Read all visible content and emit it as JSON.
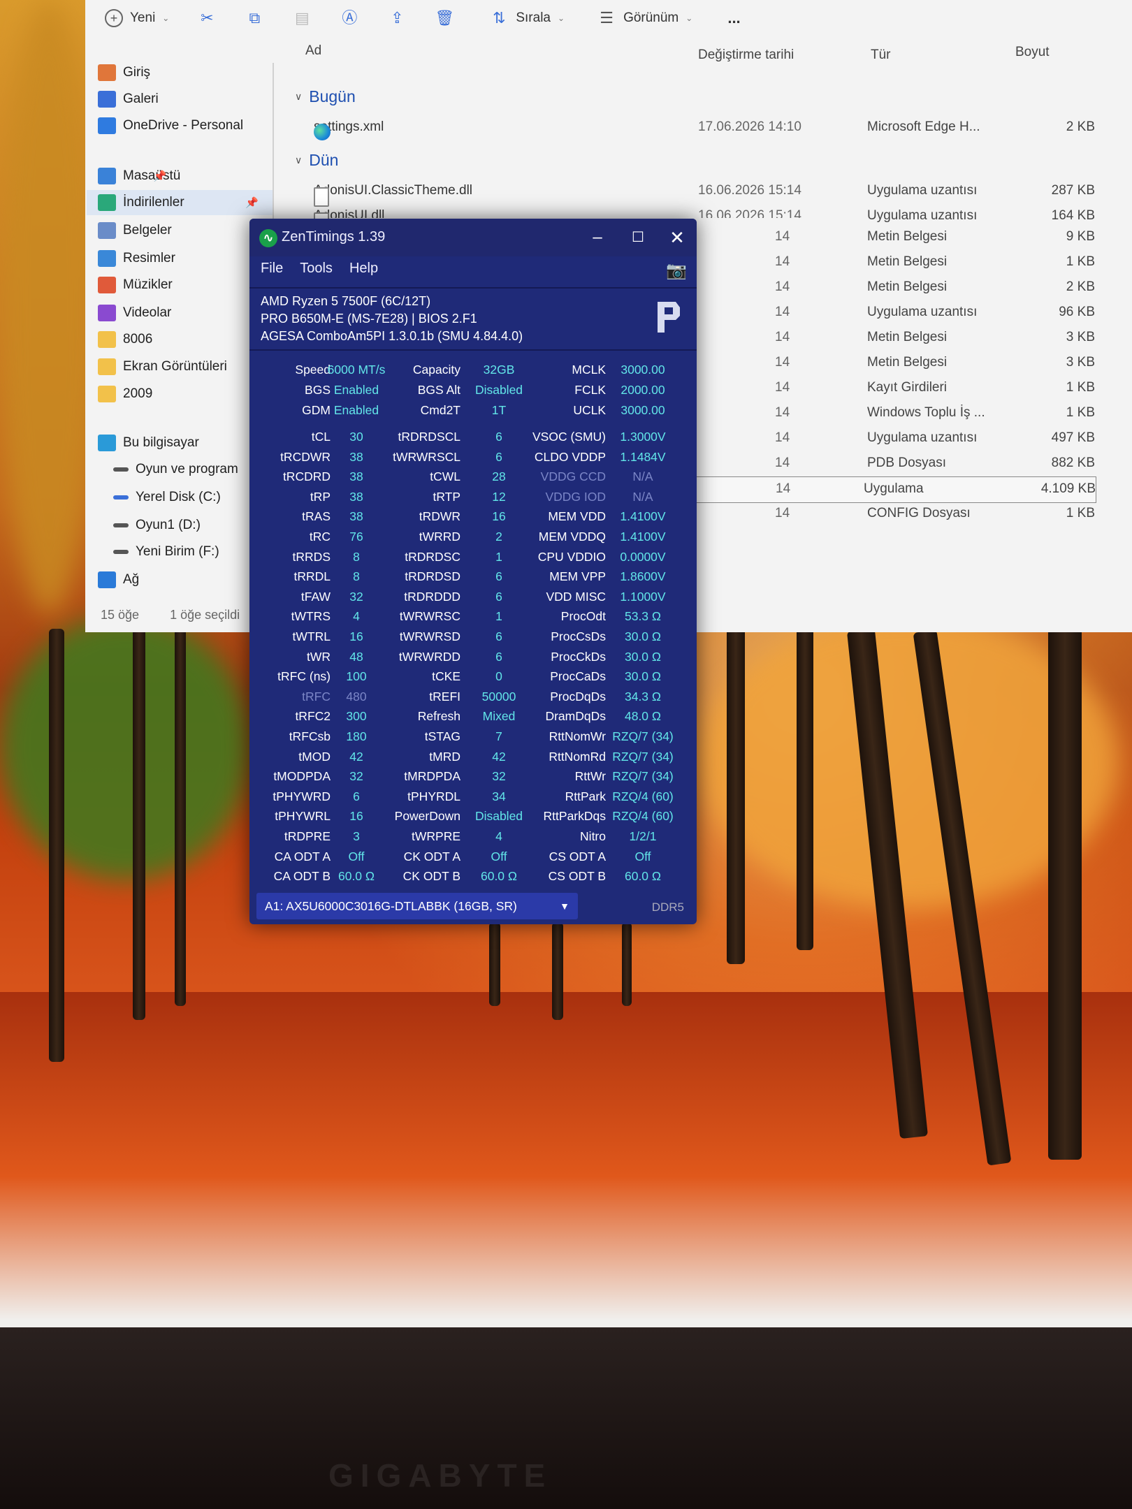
{
  "explorer": {
    "toolbar": {
      "new_label": "Yeni",
      "sort_label": "Sırala",
      "view_label": "Görünüm",
      "more_label": "..."
    },
    "columns": {
      "name": "Ad",
      "date": "Değiştirme tarihi",
      "type": "Tür",
      "size": "Boyut"
    },
    "sidebar": [
      {
        "label": "Giriş",
        "color": "#e0763a"
      },
      {
        "label": "Galeri",
        "color": "#3a6fd8"
      },
      {
        "label": "OneDrive - Personal",
        "color": "#2f7be0"
      },
      {
        "label": "Masaüstü",
        "color": "#3a82d8"
      },
      {
        "label": "İndirilenler",
        "color": "#2aa87a"
      },
      {
        "label": "Belgeler",
        "color": "#6a8cc8"
      },
      {
        "label": "Resimler",
        "color": "#3a88d8"
      },
      {
        "label": "Müzikler",
        "color": "#e05a3a"
      },
      {
        "label": "Videolar",
        "color": "#8a4ad0"
      },
      {
        "label": "8006",
        "color": "#f2c14a"
      },
      {
        "label": "Ekran Görüntüleri",
        "color": "#f2c14a"
      },
      {
        "label": "2009",
        "color": "#f2c14a"
      },
      {
        "label": "Bu bilgisayar",
        "color": "#2a9ad8"
      },
      {
        "label": "Oyun ve program",
        "color": "#555555"
      },
      {
        "label": "Yerel Disk (C:)",
        "color": "#3a6fd8"
      },
      {
        "label": "Oyun1 (D:)",
        "color": "#555555"
      },
      {
        "label": "Yeni Birim (F:)",
        "color": "#555555"
      },
      {
        "label": "Ağ",
        "color": "#2a7ad8"
      }
    ],
    "groups": {
      "today": "Bugün",
      "yesterday": "Dün"
    },
    "files": [
      {
        "name": "settings.xml",
        "date": "17.06.2026 14:10",
        "type": "Microsoft Edge H...",
        "size": "2 KB"
      },
      {
        "name": "AdonisUI.ClassicTheme.dll",
        "date": "16.06.2026 15:14",
        "type": "Uygulama uzantısı",
        "size": "287 KB"
      },
      {
        "name": "AdonisUI.dll",
        "date": "16.06.2026 15:14",
        "type": "Uygulama uzantısı",
        "size": "164 KB"
      },
      {
        "name": "",
        "date": "14",
        "type": "Metin Belgesi",
        "size": "9 KB"
      },
      {
        "name": "",
        "date": "14",
        "type": "Metin Belgesi",
        "size": "1 KB"
      },
      {
        "name": "",
        "date": "14",
        "type": "Metin Belgesi",
        "size": "2 KB"
      },
      {
        "name": "",
        "date": "14",
        "type": "Uygulama uzantısı",
        "size": "96 KB"
      },
      {
        "name": "",
        "date": "14",
        "type": "Metin Belgesi",
        "size": "3 KB"
      },
      {
        "name": "",
        "date": "14",
        "type": "Metin Belgesi",
        "size": "3 KB"
      },
      {
        "name": "",
        "date": "14",
        "type": "Kayıt Girdileri",
        "size": "1 KB"
      },
      {
        "name": "",
        "date": "14",
        "type": "Windows Toplu İş ...",
        "size": "1 KB"
      },
      {
        "name": "",
        "date": "14",
        "type": "Uygulama uzantısı",
        "size": "497 KB"
      },
      {
        "name": "",
        "date": "14",
        "type": "PDB Dosyası",
        "size": "882 KB"
      },
      {
        "name": "",
        "date": "14",
        "type": "Uygulama",
        "size": "4.109 KB"
      },
      {
        "name": "",
        "date": "14",
        "type": "CONFIG Dosyası",
        "size": "1 KB"
      }
    ],
    "status": {
      "count": "15 öğe",
      "selected": "1 öğe seçildi"
    }
  },
  "zen": {
    "title": "ZenTimings 1.39",
    "menu": [
      "File",
      "Tools",
      "Help"
    ],
    "cpu": "AMD Ryzen 5 7500F (6C/12T)",
    "board": "PRO B650M-E (MS-7E28) | BIOS 2.F1",
    "agesa": "AGESA ComboAm5PI 1.3.0.1b (SMU 4.84.4.0)",
    "top": [
      [
        "Speed",
        "6000 MT/s",
        "Capacity",
        "32GB",
        "MCLK",
        "3000.00"
      ],
      [
        "BGS",
        "Enabled",
        "BGS Alt",
        "Disabled",
        "FCLK",
        "2000.00"
      ],
      [
        "GDM",
        "Enabled",
        "Cmd2T",
        "1T",
        "UCLK",
        "3000.00"
      ]
    ],
    "timings": [
      [
        "tCL",
        "30",
        "tRDRDSCL",
        "6",
        "VSOC (SMU)",
        "1.3000V"
      ],
      [
        "tRCDWR",
        "38",
        "tWRWRSCL",
        "6",
        "CLDO VDDP",
        "1.1484V"
      ],
      [
        "tRCDRD",
        "38",
        "tCWL",
        "28",
        "VDDG CCD",
        "N/A"
      ],
      [
        "tRP",
        "38",
        "tRTP",
        "12",
        "VDDG IOD",
        "N/A"
      ],
      [
        "tRAS",
        "38",
        "tRDWR",
        "16",
        "MEM VDD",
        "1.4100V"
      ],
      [
        "tRC",
        "76",
        "tWRRD",
        "2",
        "MEM VDDQ",
        "1.4100V"
      ],
      [
        "tRRDS",
        "8",
        "tRDRDSC",
        "1",
        "CPU VDDIO",
        "0.0000V"
      ],
      [
        "tRRDL",
        "8",
        "tRDRDSD",
        "6",
        "MEM VPP",
        "1.8600V"
      ],
      [
        "tFAW",
        "32",
        "tRDRDDD",
        "6",
        "VDD MISC",
        "1.1000V"
      ],
      [
        "tWTRS",
        "4",
        "tWRWRSC",
        "1",
        "ProcOdt",
        "53.3 Ω"
      ],
      [
        "tWTRL",
        "16",
        "tWRWRSD",
        "6",
        "ProcCsDs",
        "30.0 Ω"
      ],
      [
        "tWR",
        "48",
        "tWRWRDD",
        "6",
        "ProcCkDs",
        "30.0 Ω"
      ],
      [
        "tRFC (ns)",
        "100",
        "tCKE",
        "0",
        "ProcCaDs",
        "30.0 Ω"
      ],
      [
        "tRFC",
        "480",
        "tREFI",
        "50000",
        "ProcDqDs",
        "34.3 Ω"
      ],
      [
        "tRFC2",
        "300",
        "Refresh",
        "Mixed",
        "DramDqDs",
        "48.0 Ω"
      ],
      [
        "tRFCsb",
        "180",
        "tSTAG",
        "7",
        "RttNomWr",
        "RZQ/7 (34)"
      ],
      [
        "tMOD",
        "42",
        "tMRD",
        "42",
        "RttNomRd",
        "RZQ/7 (34)"
      ],
      [
        "tMODPDA",
        "32",
        "tMRDPDA",
        "32",
        "RttWr",
        "RZQ/7 (34)"
      ],
      [
        "tPHYWRD",
        "6",
        "tPHYRDL",
        "34",
        "RttPark",
        "RZQ/4 (60)"
      ],
      [
        "tPHYWRL",
        "16",
        "PowerDown",
        "Disabled",
        "RttParkDqs",
        "RZQ/4 (60)"
      ],
      [
        "tRDPRE",
        "3",
        "tWRPRE",
        "4",
        "Nitro",
        "1/2/1"
      ],
      [
        "CA ODT A",
        "Off",
        "CK ODT A",
        "Off",
        "CS ODT A",
        "Off"
      ],
      [
        "CA ODT B",
        "60.0 Ω",
        "CK ODT B",
        "60.0 Ω",
        "CS ODT B",
        "60.0 Ω"
      ]
    ],
    "dimm": "A1: AX5U6000C3016G-DTLABBK (16GB, SR)",
    "ddr": "DDR5",
    "colors": {
      "value": "#62e5e8",
      "bg": "#1f2a78"
    }
  },
  "monitor_brand": "GIGABYTE"
}
